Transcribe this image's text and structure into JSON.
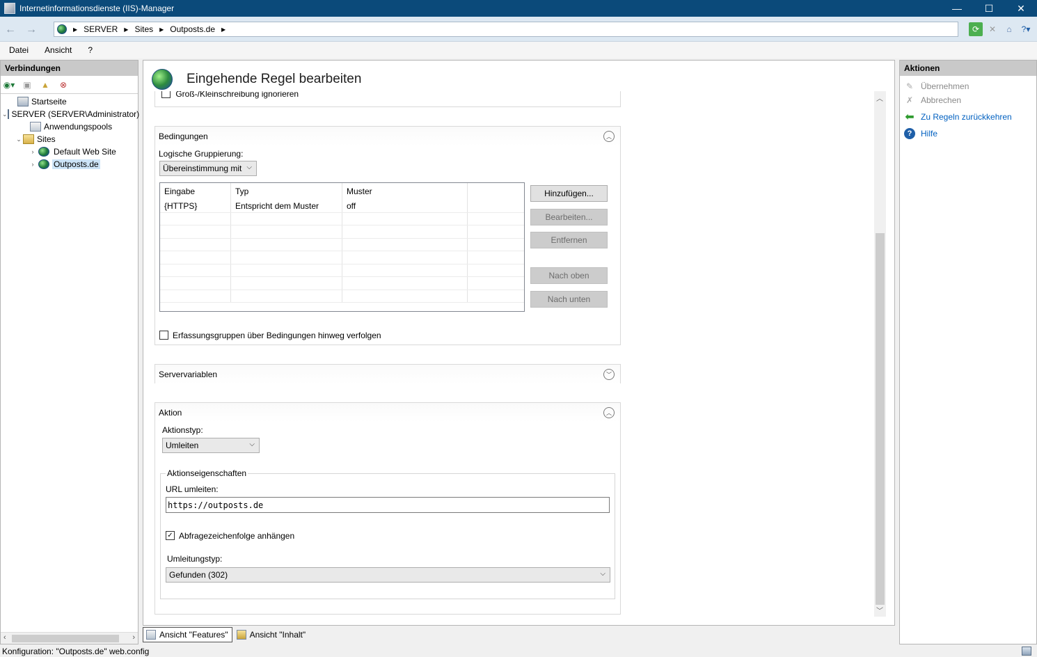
{
  "window": {
    "title": "Internetinformationsdienste (IIS)-Manager",
    "minimize": "—",
    "maximize": "☐",
    "close": "✕"
  },
  "address": {
    "crumbs": [
      "SERVER",
      "Sites",
      "Outposts.de"
    ],
    "back": "←",
    "forward": "→"
  },
  "menu": [
    "Datei",
    "Ansicht",
    "?"
  ],
  "connections": {
    "header": "Verbindungen",
    "tree": [
      {
        "label": "Startseite"
      },
      {
        "label": "SERVER (SERVER\\Administrator)"
      },
      {
        "label": "Anwendungspools"
      },
      {
        "label": "Sites"
      },
      {
        "label": "Default Web Site"
      },
      {
        "label": "Outposts.de"
      }
    ]
  },
  "page": {
    "title": "Eingehende Regel bearbeiten",
    "top_partial_checkbox": "Groß-/Kleinschreibung ignorieren",
    "conditions": {
      "header": "Bedingungen",
      "grouping_label": "Logische Gruppierung:",
      "grouping_value": "Übereinstimmung mit",
      "columns": [
        "Eingabe",
        "Typ",
        "Muster",
        ""
      ],
      "rows": [
        [
          "{HTTPS}",
          "Entspricht dem Muster",
          "off",
          ""
        ]
      ],
      "buttons": {
        "add": "Hinzufügen...",
        "edit": "Bearbeiten...",
        "remove": "Entfernen",
        "up": "Nach oben",
        "down": "Nach unten"
      },
      "track_groups_label": "Erfassungsgruppen über Bedingungen hinweg verfolgen",
      "track_groups_checked": false
    },
    "server_vars": {
      "header": "Servervariablen"
    },
    "action": {
      "header": "Aktion",
      "type_label": "Aktionstyp:",
      "type_value": "Umleiten",
      "props_legend": "Aktionseigenschaften",
      "url_label": "URL umleiten:",
      "url_value": "https://outposts.de",
      "append_query_label": "Abfragezeichenfolge anhängen",
      "append_query_checked": true,
      "redirect_type_label": "Umleitungstyp:",
      "redirect_type_value": "Gefunden (302)"
    }
  },
  "view_tabs": {
    "features": "Ansicht \"Features\"",
    "content": "Ansicht \"Inhalt\""
  },
  "actions": {
    "header": "Aktionen",
    "items": [
      {
        "label": "Übernehmen",
        "enabled": false
      },
      {
        "label": "Abbrechen",
        "enabled": false
      },
      {
        "label": "Zu Regeln zurückkehren",
        "enabled": true
      },
      {
        "label": "Hilfe",
        "enabled": true
      }
    ]
  },
  "status": {
    "text": "Konfiguration: \"Outposts.de\" web.config"
  }
}
